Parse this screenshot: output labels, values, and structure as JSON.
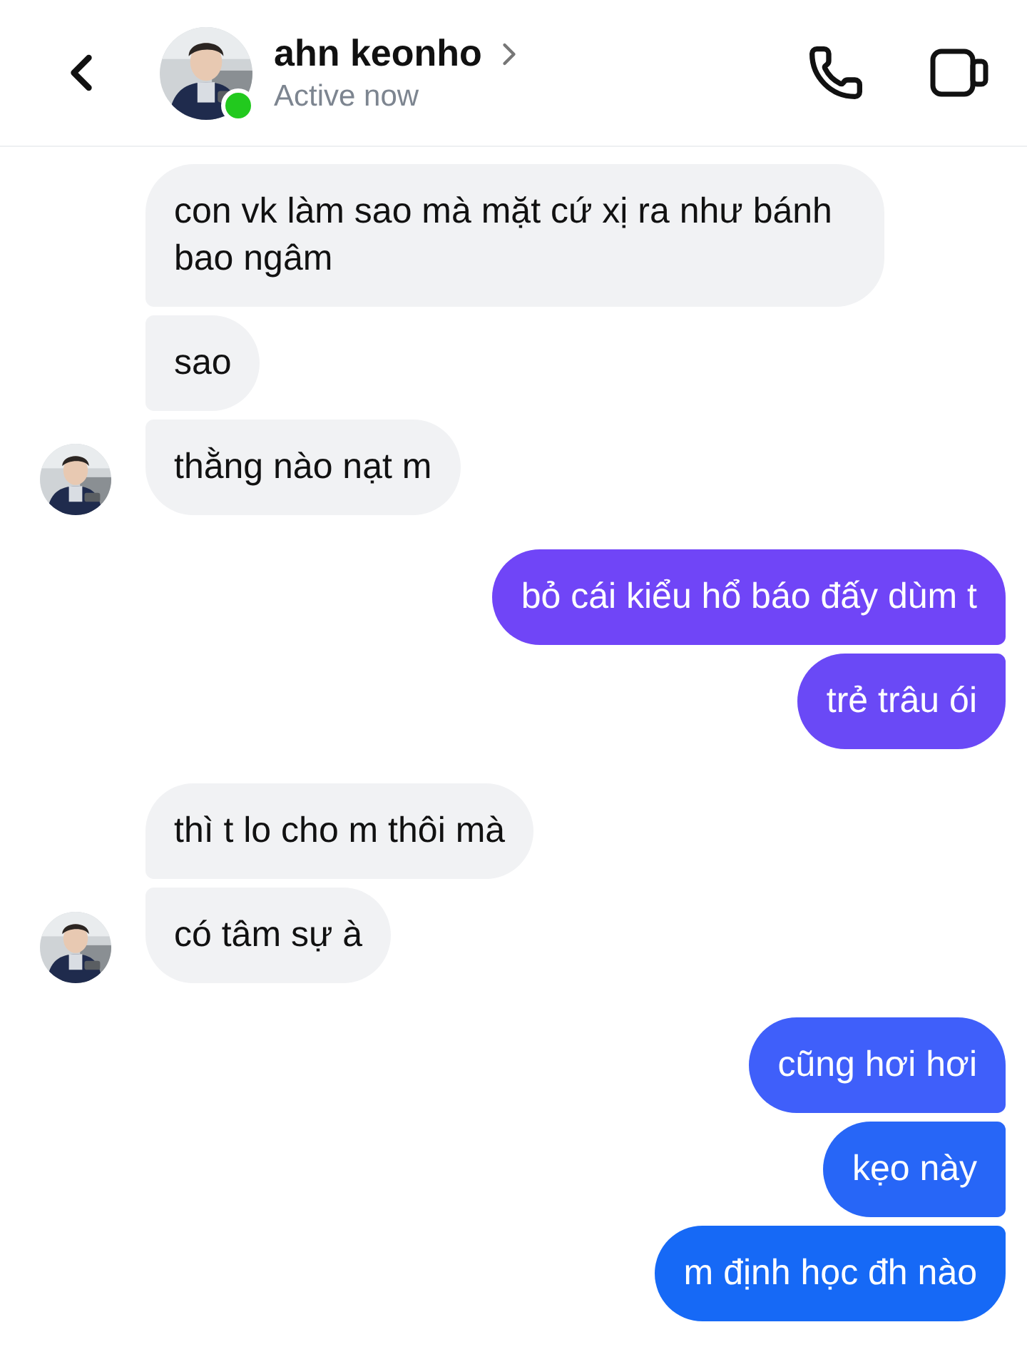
{
  "header": {
    "name": "ahn keonho",
    "status": "Active now",
    "online": true
  },
  "groups": [
    {
      "kind": "incoming",
      "messages": [
        {
          "text": "con vk làm sao mà mặt cứ xị ra như bánh bao ngâm"
        },
        {
          "text": "sao"
        },
        {
          "text": "thằng nào nạt m"
        }
      ]
    },
    {
      "kind": "outgoing",
      "messages": [
        {
          "text": "bỏ cái kiểu hổ báo đấy dùm t",
          "color": "#7045f7"
        },
        {
          "text": "trẻ trâu ói",
          "color": "#6a49f6"
        }
      ]
    },
    {
      "kind": "incoming",
      "messages": [
        {
          "text": "thì t lo cho m thôi mà"
        },
        {
          "text": "có tâm sự à"
        }
      ]
    },
    {
      "kind": "outgoing",
      "messages": [
        {
          "text": "cũng hơi hơi",
          "color": "#3f5ffa"
        },
        {
          "text": "kẹo này",
          "color": "#2766f7"
        },
        {
          "text": "m định học đh nào",
          "color": "#1669f6"
        }
      ]
    }
  ]
}
